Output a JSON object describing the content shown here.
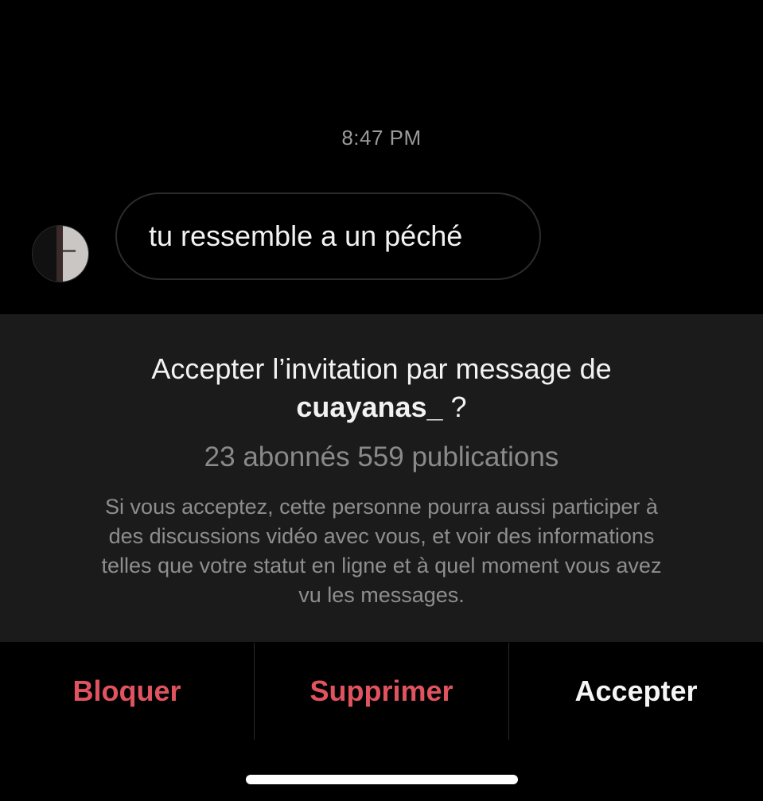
{
  "conversation": {
    "timestamp": "8:47 PM",
    "message": {
      "text": "tu ressemble a un péché"
    }
  },
  "request": {
    "title": "Accepter l’invitation par message de",
    "username": "cuayanas_",
    "question_mark": " ?",
    "stats": "23 abonnés 559 publications",
    "description_lines": [
      "Si vous acceptez, cette personne pourra aussi participer à",
      "des discussions vidéo avec vous, et voir des informations",
      "telles que votre statut en ligne et à quel moment vous avez",
      "vu les messages."
    ]
  },
  "actions": {
    "block_label": "Bloquer",
    "delete_label": "Supprimer",
    "accept_label": "Accepter"
  },
  "colors": {
    "background": "#000000",
    "panel": "#1b1b1b",
    "danger": "#e0535f",
    "muted_text": "#8e8e8e"
  }
}
